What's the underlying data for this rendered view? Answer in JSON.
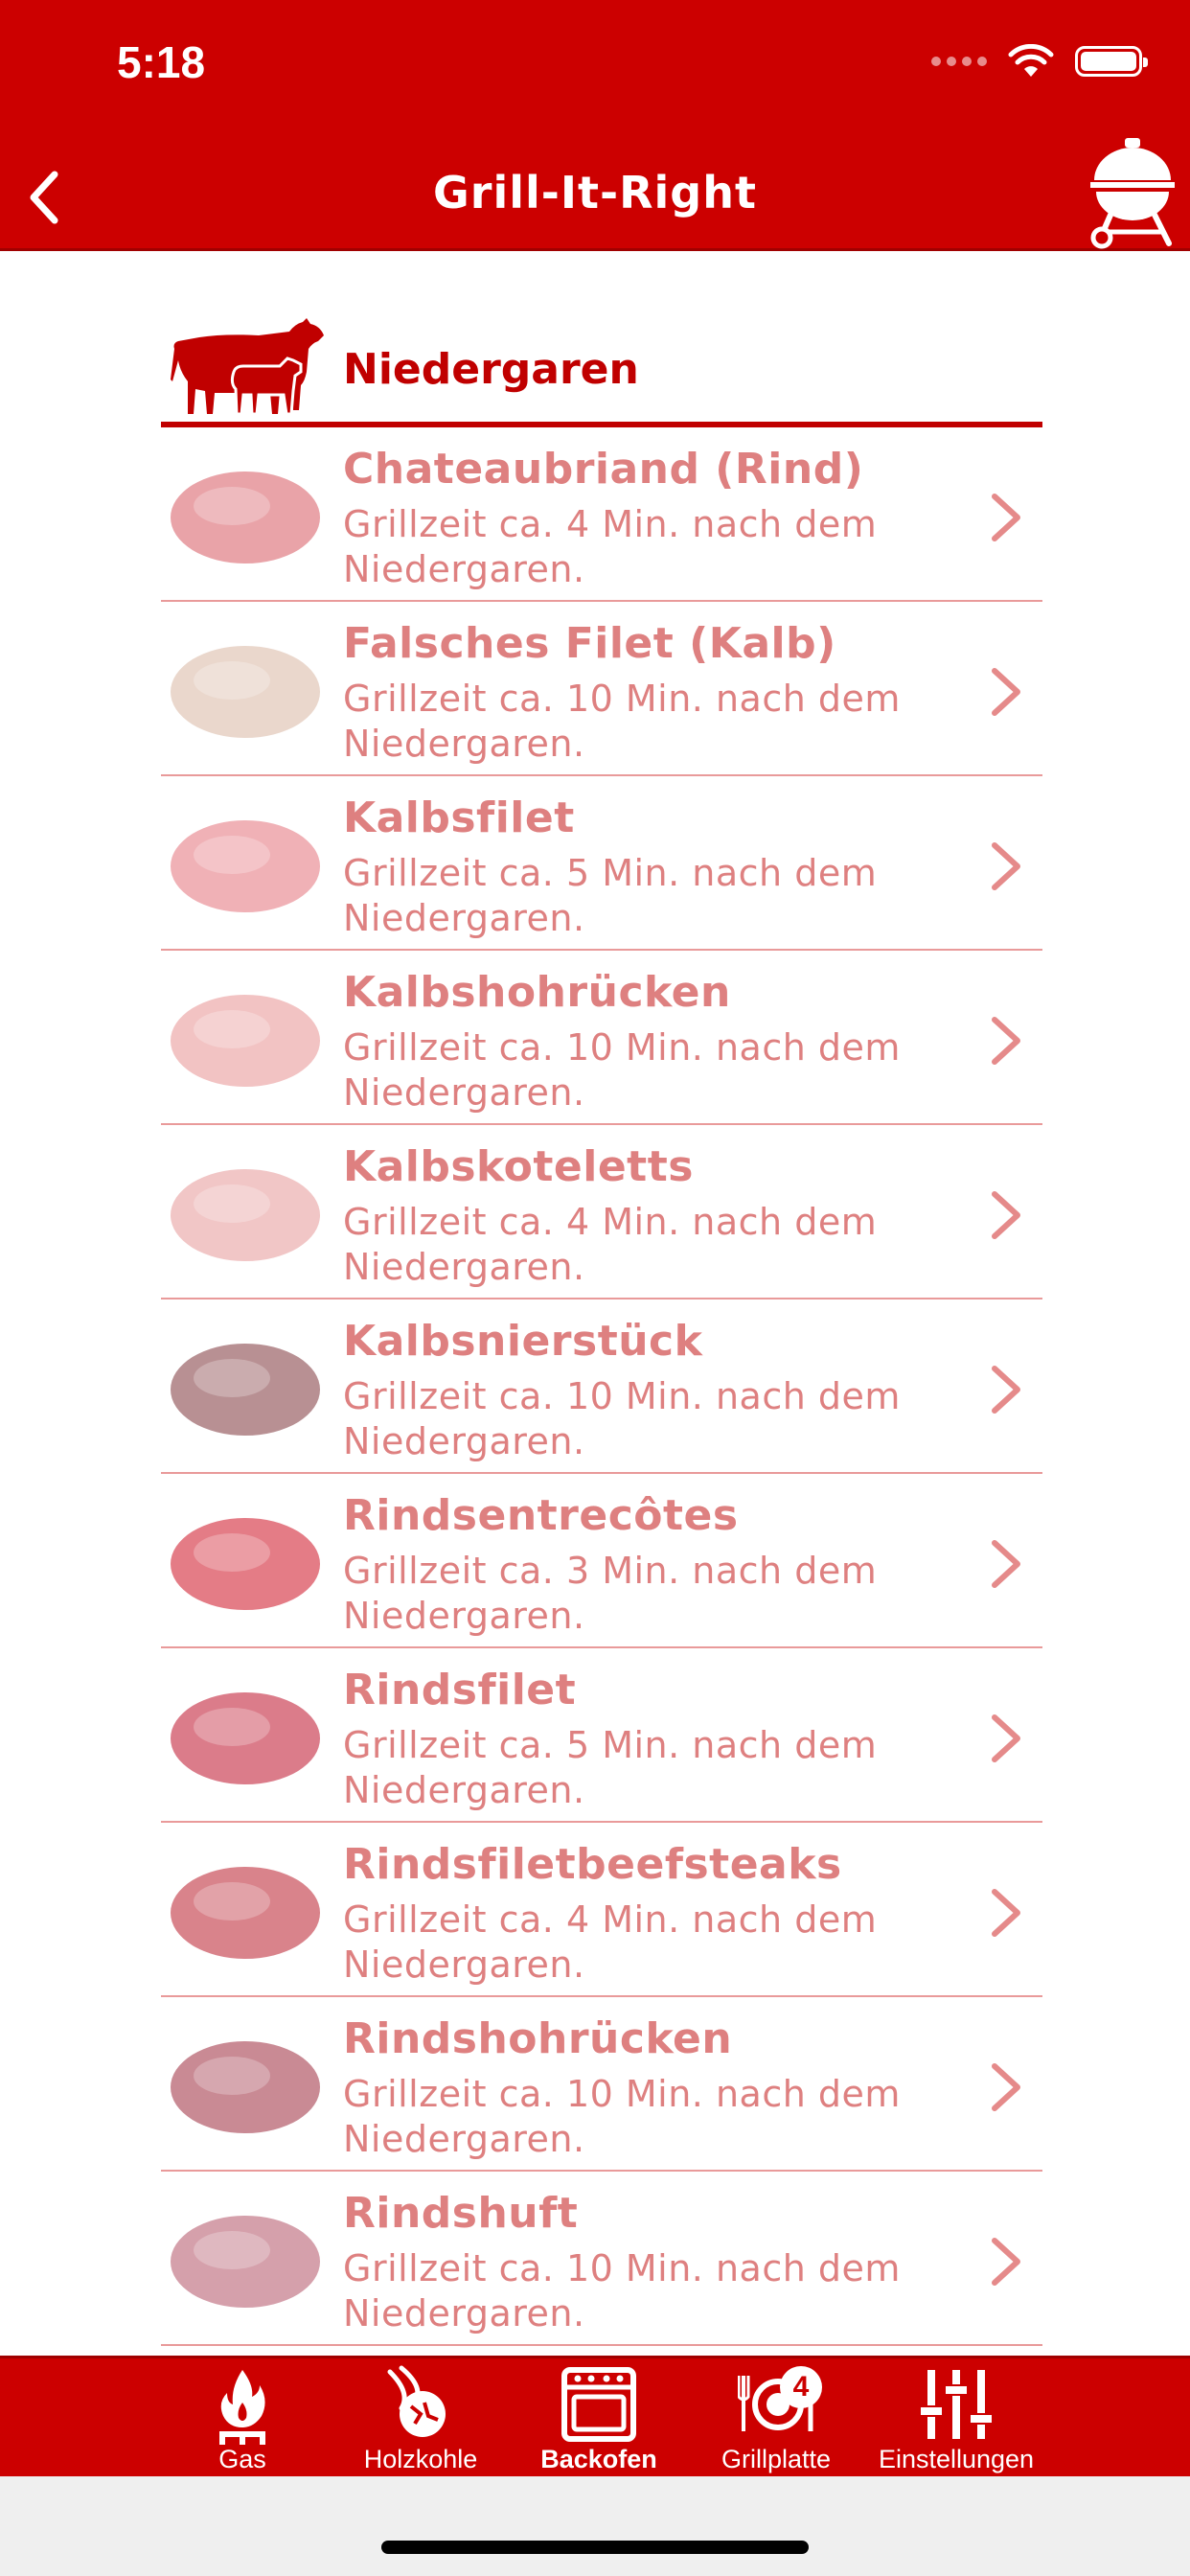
{
  "status_bar": {
    "time": "5:18"
  },
  "nav": {
    "title": "Grill-It-Right",
    "back_icon": "chevron-left-icon",
    "right_icon": "kettle-grill-icon"
  },
  "section": {
    "title": "Niedergaren",
    "icon": "cattle-icon"
  },
  "items": [
    {
      "name": "Chateaubriand (Rind)",
      "desc": "Grillzeit ca. 4 Min. nach dem Niedergaren."
    },
    {
      "name": "Falsches Filet (Kalb)",
      "desc": "Grillzeit ca. 10 Min. nach dem Niedergaren."
    },
    {
      "name": "Kalbsfilet",
      "desc": "Grillzeit ca. 5 Min. nach dem Niedergaren."
    },
    {
      "name": "Kalbshohrücken",
      "desc": "Grillzeit ca. 10 Min. nach dem Niedergaren."
    },
    {
      "name": "Kalbskoteletts",
      "desc": "Grillzeit ca. 4 Min. nach dem Niedergaren."
    },
    {
      "name": "Kalbsnierstück",
      "desc": "Grillzeit ca. 10 Min. nach dem Niedergaren."
    },
    {
      "name": "Rindsentrecôtes",
      "desc": "Grillzeit ca. 3 Min. nach dem Niedergaren."
    },
    {
      "name": "Rindsfilet",
      "desc": "Grillzeit ca. 5 Min. nach dem Niedergaren."
    },
    {
      "name": "Rindsfiletbeefsteaks",
      "desc": "Grillzeit ca. 4 Min. nach dem Niedergaren."
    },
    {
      "name": "Rindshohrücken",
      "desc": "Grillzeit ca. 10 Min. nach dem Niedergaren."
    },
    {
      "name": "Rindshuft",
      "desc": "Grillzeit ca. 10 Min. nach dem Niedergaren."
    }
  ],
  "tabs": [
    {
      "label": "Gas",
      "icon": "gas-flame-icon",
      "active": false
    },
    {
      "label": "Holzkohle",
      "icon": "charcoal-icon",
      "active": false
    },
    {
      "label": "Backofen",
      "icon": "oven-icon",
      "active": true
    },
    {
      "label": "Grillplatte",
      "icon": "grill-plate-icon",
      "active": false,
      "badge": "4"
    },
    {
      "label": "Einstellungen",
      "icon": "settings-sliders-icon",
      "active": false
    }
  ],
  "colors": {
    "brand_red": "#cc0000",
    "item_text": "#de8080",
    "divider": "#e99a9a"
  }
}
